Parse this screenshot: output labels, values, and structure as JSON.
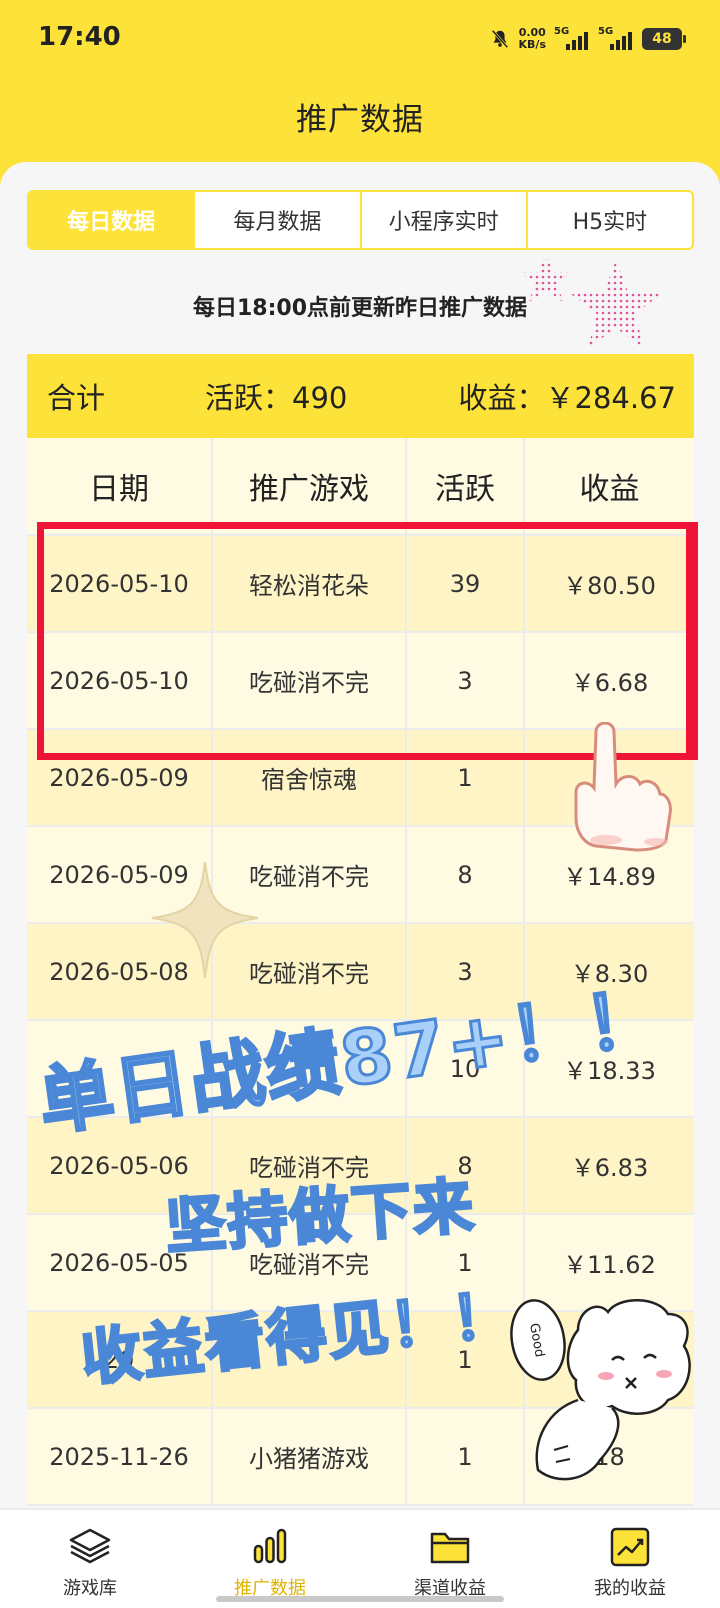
{
  "status_bar": {
    "time": "17:40",
    "net_speed": "0.00",
    "net_unit": "KB/s",
    "sim1": "5G",
    "sim2": "5G",
    "battery": "48"
  },
  "header": {
    "title": "推广数据"
  },
  "tabs": [
    {
      "label": "每日数据",
      "active": true
    },
    {
      "label": "每月数据",
      "active": false
    },
    {
      "label": "小程序实时",
      "active": false
    },
    {
      "label": "H5实时",
      "active": false
    }
  ],
  "notice": "每日18:00点前更新昨日推广数据",
  "summary": {
    "label": "合计",
    "active": "活跃：490",
    "income": "收益：￥284.67"
  },
  "table": {
    "columns": [
      "日期",
      "推广游戏",
      "活跃",
      "收益"
    ],
    "rows": [
      [
        "2026-05-10",
        "轻松消花朵",
        "39",
        "￥80.50"
      ],
      [
        "2026-05-10",
        "吃碰消不完",
        "3",
        "￥6.68"
      ],
      [
        "2026-05-09",
        "宿舍惊魂",
        "1",
        "￥"
      ],
      [
        "2026-05-09",
        "吃碰消不完",
        "8",
        "￥14.89"
      ],
      [
        "2026-05-08",
        "吃碰消不完",
        "3",
        "￥8.30"
      ],
      [
        "",
        "",
        "10",
        "￥18.33"
      ],
      [
        "2026-05-06",
        "吃碰消不完",
        "8",
        "￥6.83"
      ],
      [
        "2026-05-05",
        "吃碰消不完",
        "1",
        "￥11.62"
      ],
      [
        "20",
        "",
        "1",
        ""
      ],
      [
        "2025-11-26",
        "小猪猪游戏",
        "1",
        "18"
      ]
    ]
  },
  "overlay": {
    "line1": "单日战绩87+！！",
    "line2": "坚持做下来",
    "line3": "收益看得见！！",
    "sticker_text": "Good"
  },
  "bottom_nav": [
    {
      "label": "游戏库",
      "icon": "layers-icon",
      "active": false
    },
    {
      "label": "推广数据",
      "icon": "bar-chart-icon",
      "active": true
    },
    {
      "label": "渠道收益",
      "icon": "folder-icon",
      "active": false
    },
    {
      "label": "我的收益",
      "icon": "trend-chart-icon",
      "active": false
    }
  ],
  "colors": {
    "brand_yellow": "#fde23a",
    "highlight_red": "#ef1338",
    "overlay_blue": "#4a87d6"
  }
}
